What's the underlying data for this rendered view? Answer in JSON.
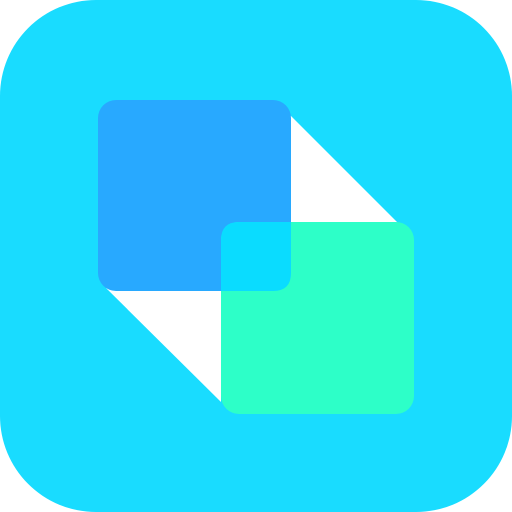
{
  "icon": {
    "name": "overlapping-squares-app-icon",
    "colors": {
      "background": "#19DCFF",
      "back_square": "#28A9FF",
      "front_square": "#2DFFC8",
      "overlap": "#0ADCFF",
      "connector": "#FFFFFF"
    }
  }
}
